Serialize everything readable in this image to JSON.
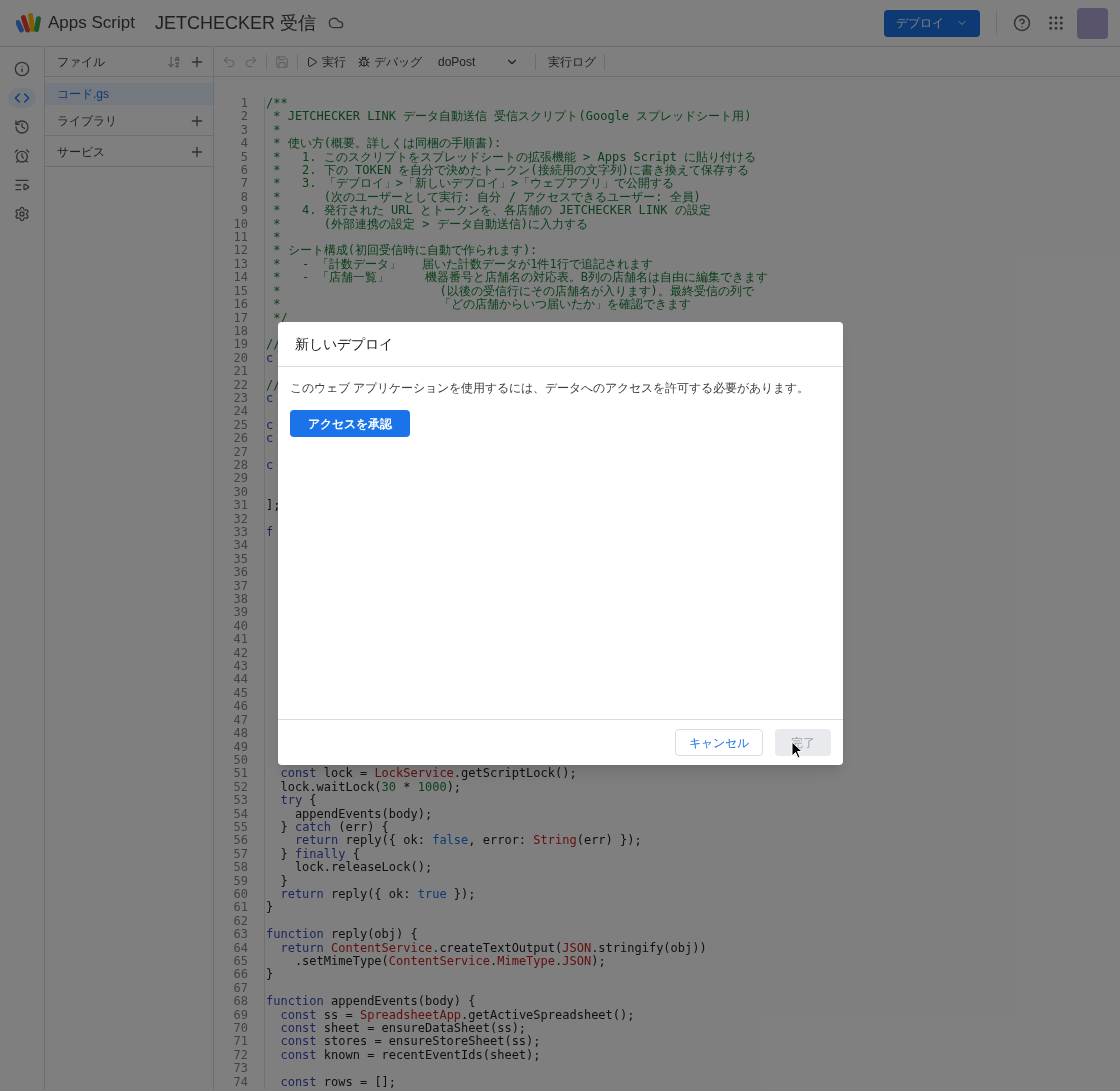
{
  "app": {
    "name": "Apps Script",
    "project_title": "JETCHECKER 受信"
  },
  "deploy_button": "デプロイ",
  "rail": [
    {
      "selected": false
    },
    {
      "selected": true
    },
    {
      "selected": false
    },
    {
      "selected": false
    },
    {
      "selected": false
    },
    {
      "selected": false
    }
  ],
  "file_panel": {
    "title": "ファイル",
    "files": [
      {
        "name": "コード.gs",
        "selected": true
      }
    ],
    "sections": [
      "ライブラリ",
      "サービス"
    ]
  },
  "toolbar": {
    "run": "実行",
    "debug": "デバッグ",
    "function": "doPost",
    "log": "実行ログ"
  },
  "code_lines": [
    {
      "n": "1",
      "tokens": [
        {
          "kind": "comment",
          "text": "/**"
        }
      ]
    },
    {
      "n": "2",
      "tokens": [
        {
          "kind": "comment",
          "text": " * JETCHECKER LINK データ自動送信 受信スクリプト(Google スプレッドシート用)"
        }
      ]
    },
    {
      "n": "3",
      "tokens": [
        {
          "kind": "comment",
          "text": " *"
        }
      ]
    },
    {
      "n": "4",
      "tokens": [
        {
          "kind": "comment",
          "text": " * 使い方(概要。詳しくは同梱の手順書):"
        }
      ]
    },
    {
      "n": "5",
      "tokens": [
        {
          "kind": "comment",
          "text": " *   1. このスクリプトをスプレッドシートの拡張機能 > Apps Script に貼り付ける"
        }
      ]
    },
    {
      "n": "6",
      "tokens": [
        {
          "kind": "comment",
          "text": " *   2. 下の TOKEN を自分で決めたトークン(接続用の文字列)に書き換えて保存する"
        }
      ]
    },
    {
      "n": "7",
      "tokens": [
        {
          "kind": "comment",
          "text": " *   3. 「デプロイ」>「新しいデプロイ」>「ウェブアプリ」で公開する"
        }
      ]
    },
    {
      "n": "8",
      "tokens": [
        {
          "kind": "comment",
          "text": " *      (次のユーザーとして実行: 自分 / アクセスできるユーザー: 全員)"
        }
      ]
    },
    {
      "n": "9",
      "tokens": [
        {
          "kind": "comment",
          "text": " *   4. 発行された URL とトークンを、各店舗の JETCHECKER LINK の設定"
        }
      ]
    },
    {
      "n": "10",
      "tokens": [
        {
          "kind": "comment",
          "text": " *      (外部連携の設定 > データ自動送信)に入力する"
        }
      ]
    },
    {
      "n": "11",
      "tokens": [
        {
          "kind": "comment",
          "text": " *"
        }
      ]
    },
    {
      "n": "12",
      "tokens": [
        {
          "kind": "comment",
          "text": " * シート構成(初回受信時に自動で作られます):"
        }
      ]
    },
    {
      "n": "13",
      "tokens": [
        {
          "kind": "comment",
          "text": " *   - 「計数データ」   届いた計数データが1件1行で追記されます"
        }
      ]
    },
    {
      "n": "14",
      "tokens": [
        {
          "kind": "comment",
          "text": " *   - 「店舗一覧」     機器番号と店舗名の対応表。B列の店舗名は自由に編集できます"
        }
      ]
    },
    {
      "n": "15",
      "tokens": [
        {
          "kind": "comment",
          "text": " *                      (以後の受信行にその店舗名が入ります)。最終受信の列で"
        }
      ]
    },
    {
      "n": "16",
      "tokens": [
        {
          "kind": "comment",
          "text": " *                      「どの店舗からいつ届いたか」を確認できます"
        }
      ]
    },
    {
      "n": "17",
      "tokens": [
        {
          "kind": "comment",
          "text": " */"
        }
      ]
    },
    {
      "n": "18"
    },
    {
      "n": "19",
      "tokens": [
        {
          "kind": "comment",
          "text": "//"
        }
      ]
    },
    {
      "n": "20",
      "tokens": [
        {
          "kind": "keyword",
          "text": "c"
        }
      ]
    },
    {
      "n": "21"
    },
    {
      "n": "22",
      "tokens": [
        {
          "kind": "comment",
          "text": "//"
        }
      ]
    },
    {
      "n": "23",
      "tokens": [
        {
          "kind": "keyword",
          "text": "c"
        }
      ]
    },
    {
      "n": "24"
    },
    {
      "n": "25",
      "tokens": [
        {
          "kind": "keyword",
          "text": "c"
        }
      ]
    },
    {
      "n": "26",
      "tokens": [
        {
          "kind": "keyword",
          "text": "c"
        }
      ]
    },
    {
      "n": "27"
    },
    {
      "n": "28",
      "tokens": [
        {
          "kind": "keyword",
          "text": "c"
        }
      ]
    },
    {
      "n": "29"
    },
    {
      "n": "30"
    },
    {
      "n": "31",
      "tokens": [
        {
          "kind": "plain",
          "text": "];"
        }
      ]
    },
    {
      "n": "32"
    },
    {
      "n": "33",
      "tokens": [
        {
          "kind": "keyword",
          "text": "f"
        }
      ]
    },
    {
      "n": "34"
    },
    {
      "n": "35"
    },
    {
      "n": "36"
    },
    {
      "n": "37"
    },
    {
      "n": "38"
    },
    {
      "n": "39"
    },
    {
      "n": "40"
    },
    {
      "n": "41"
    },
    {
      "n": "42"
    },
    {
      "n": "43"
    },
    {
      "n": "44"
    },
    {
      "n": "45"
    },
    {
      "n": "46"
    },
    {
      "n": "47"
    },
    {
      "n": "48"
    },
    {
      "n": "49"
    },
    {
      "n": "50"
    },
    {
      "n": "51",
      "tokens": [
        {
          "kind": "keyword",
          "text": "  const"
        },
        {
          "kind": "plain",
          "text": " lock = "
        },
        {
          "kind": "object",
          "text": "LockService"
        },
        {
          "kind": "plain",
          "text": ".getScriptLock();"
        }
      ]
    },
    {
      "n": "52",
      "tokens": [
        {
          "kind": "plain",
          "text": "  lock.waitLock("
        },
        {
          "kind": "number",
          "text": "30"
        },
        {
          "kind": "plain",
          "text": " * "
        },
        {
          "kind": "number",
          "text": "1000"
        },
        {
          "kind": "plain",
          "text": ");"
        }
      ]
    },
    {
      "n": "53",
      "tokens": [
        {
          "kind": "keyword",
          "text": "  try"
        },
        {
          "kind": "plain",
          "text": " {"
        }
      ]
    },
    {
      "n": "54",
      "tokens": [
        {
          "kind": "plain",
          "text": "    appendEvents(body);"
        }
      ]
    },
    {
      "n": "55",
      "tokens": [
        {
          "kind": "plain",
          "text": "  } "
        },
        {
          "kind": "keyword",
          "text": "catch"
        },
        {
          "kind": "plain",
          "text": " (err) {"
        }
      ]
    },
    {
      "n": "56",
      "tokens": [
        {
          "kind": "keyword",
          "text": "    return"
        },
        {
          "kind": "plain",
          "text": " reply({ ok: "
        },
        {
          "kind": "literal",
          "text": "false"
        },
        {
          "kind": "plain",
          "text": ", error: "
        },
        {
          "kind": "object",
          "text": "String"
        },
        {
          "kind": "plain",
          "text": "(err) });"
        }
      ]
    },
    {
      "n": "57",
      "tokens": [
        {
          "kind": "plain",
          "text": "  } "
        },
        {
          "kind": "keyword",
          "text": "finally"
        },
        {
          "kind": "plain",
          "text": " {"
        }
      ]
    },
    {
      "n": "58",
      "tokens": [
        {
          "kind": "plain",
          "text": "    lock.releaseLock();"
        }
      ]
    },
    {
      "n": "59",
      "tokens": [
        {
          "kind": "plain",
          "text": "  }"
        }
      ]
    },
    {
      "n": "60",
      "tokens": [
        {
          "kind": "keyword",
          "text": "  return"
        },
        {
          "kind": "plain",
          "text": " reply({ ok: "
        },
        {
          "kind": "literal",
          "text": "true"
        },
        {
          "kind": "plain",
          "text": " });"
        }
      ]
    },
    {
      "n": "61",
      "tokens": [
        {
          "kind": "plain",
          "text": "}"
        }
      ]
    },
    {
      "n": "62"
    },
    {
      "n": "63",
      "tokens": [
        {
          "kind": "keyword",
          "text": "function"
        },
        {
          "kind": "plain",
          "text": " reply(obj) {"
        }
      ]
    },
    {
      "n": "64",
      "tokens": [
        {
          "kind": "keyword",
          "text": "  return"
        },
        {
          "kind": "object",
          "text": " ContentService"
        },
        {
          "kind": "plain",
          "text": ".createTextOutput("
        },
        {
          "kind": "object",
          "text": "JSON"
        },
        {
          "kind": "plain",
          "text": ".stringify(obj))"
        }
      ]
    },
    {
      "n": "65",
      "tokens": [
        {
          "kind": "plain",
          "text": "    .setMimeType("
        },
        {
          "kind": "object",
          "text": "ContentService"
        },
        {
          "kind": "plain",
          "text": "."
        },
        {
          "kind": "object",
          "text": "MimeType"
        },
        {
          "kind": "plain",
          "text": "."
        },
        {
          "kind": "object",
          "text": "JSON"
        },
        {
          "kind": "plain",
          "text": ");"
        }
      ]
    },
    {
      "n": "66",
      "tokens": [
        {
          "kind": "plain",
          "text": "}"
        }
      ]
    },
    {
      "n": "67"
    },
    {
      "n": "68",
      "tokens": [
        {
          "kind": "keyword",
          "text": "function"
        },
        {
          "kind": "plain",
          "text": " appendEvents(body) {"
        }
      ]
    },
    {
      "n": "69",
      "tokens": [
        {
          "kind": "keyword",
          "text": "  const"
        },
        {
          "kind": "plain",
          "text": " ss = "
        },
        {
          "kind": "object",
          "text": "SpreadsheetApp"
        },
        {
          "kind": "plain",
          "text": ".getActiveSpreadsheet();"
        }
      ]
    },
    {
      "n": "70",
      "tokens": [
        {
          "kind": "keyword",
          "text": "  const"
        },
        {
          "kind": "plain",
          "text": " sheet = ensureDataSheet(ss);"
        }
      ]
    },
    {
      "n": "71",
      "tokens": [
        {
          "kind": "keyword",
          "text": "  const"
        },
        {
          "kind": "plain",
          "text": " stores = ensureStoreSheet(ss);"
        }
      ]
    },
    {
      "n": "72",
      "tokens": [
        {
          "kind": "keyword",
          "text": "  const"
        },
        {
          "kind": "plain",
          "text": " known = recentEventIds(sheet);"
        }
      ]
    },
    {
      "n": "73"
    },
    {
      "n": "74",
      "tokens": [
        {
          "kind": "keyword",
          "text": "  const"
        },
        {
          "kind": "plain",
          "text": " rows = [];"
        }
      ]
    }
  ],
  "dialog": {
    "title": "新しいデプロイ",
    "message": "このウェブ アプリケーションを使用するには、データへのアクセスを許可する必要があります。",
    "authorize_button": "アクセスを承認",
    "cancel_button": "キャンセル",
    "done_button": {
      "label": "完了",
      "disabled": true
    }
  }
}
